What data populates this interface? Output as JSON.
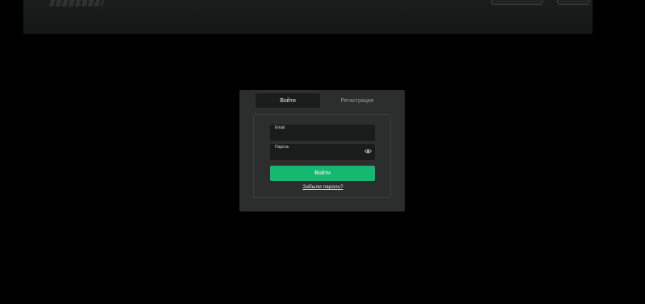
{
  "auth_modal": {
    "tabs": {
      "login": "Войти",
      "register": "Регистрация"
    },
    "email": {
      "label": "Email",
      "value": ""
    },
    "password": {
      "label": "Пароль",
      "value": ""
    },
    "submit_label": "Войти",
    "forgot_link": "Забыли пароль?"
  },
  "colors": {
    "page_background": "#000000",
    "modal_background": "#2c2d2d",
    "input_background": "#1a1b1b",
    "accent_green": "#14b86e"
  },
  "icons": {
    "password_toggle": "eye-icon"
  }
}
